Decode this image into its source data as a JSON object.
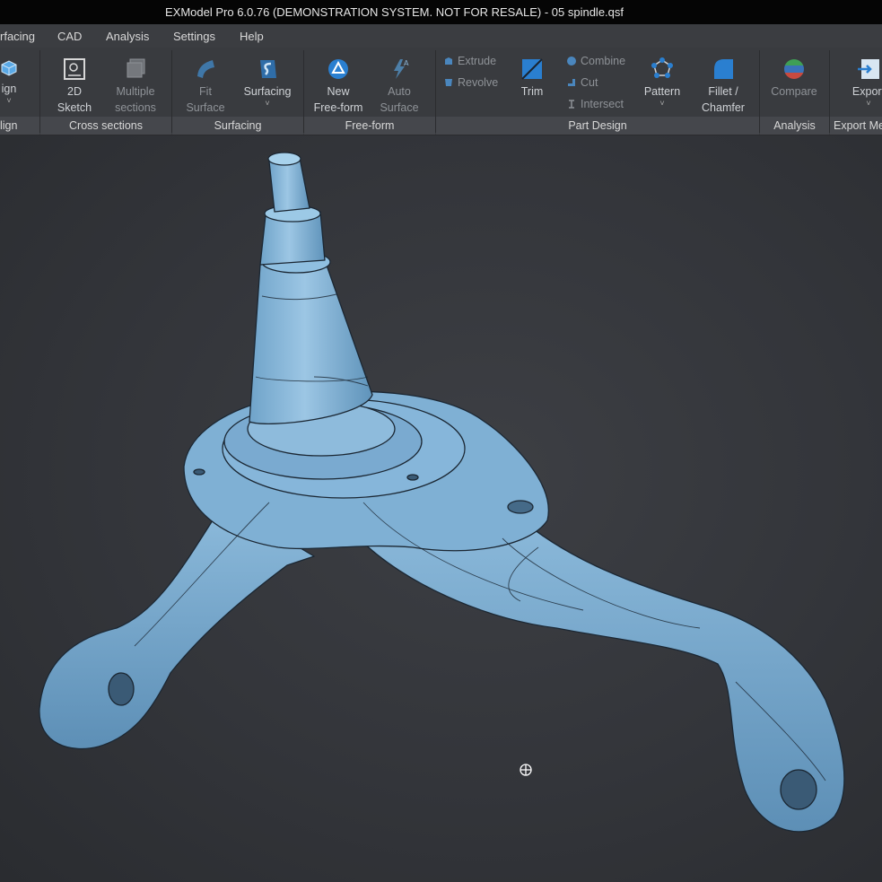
{
  "window": {
    "title": "EXModel Pro 6.0.76 (DEMONSTRATION SYSTEM. NOT FOR RESALE) - 05 spindle.qsf"
  },
  "menu": {
    "items": [
      "rfacing",
      "CAD",
      "Analysis",
      "Settings",
      "Help"
    ]
  },
  "ribbon": {
    "groups": {
      "design": "lign",
      "cross_sections": "Cross sections",
      "surfacing": "Surfacing",
      "free_form": "Free-form",
      "part_design": "Part Design",
      "analysis": "Analysis",
      "export": "Export Me"
    },
    "buttons": {
      "design_partial": "ign",
      "sketch_2d": [
        "2D",
        "Sketch"
      ],
      "multiple_sections": [
        "Multiple",
        "sections"
      ],
      "fit_surface": [
        "Fit",
        "Surface"
      ],
      "surfacing": "Surfacing",
      "new_free_form": [
        "New",
        "Free-form"
      ],
      "auto_surface": [
        "Auto",
        "Surface"
      ],
      "extrude": "Extrude",
      "revolve": "Revolve",
      "trim": "Trim",
      "combine": "Combine",
      "cut": "Cut",
      "intersect": "Intersect",
      "pattern": "Pattern",
      "fillet_chamfer": [
        "Fillet /",
        "Chamfer"
      ],
      "compare": "Compare",
      "export": "Export"
    },
    "chevron": "˅"
  },
  "colors": {
    "accent": "#4aa3e8",
    "model": "#7eb0d4",
    "viewport": "#33353a"
  }
}
